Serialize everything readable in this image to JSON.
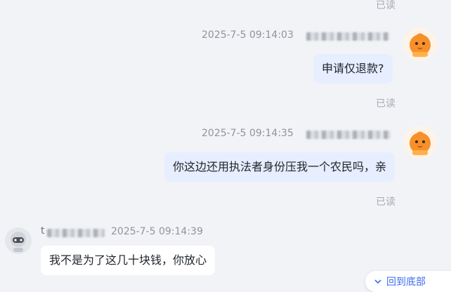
{
  "messages": [
    {
      "direction": "out",
      "status": "已读"
    },
    {
      "direction": "out",
      "timestamp": "2025-7-5 09:14:03",
      "text": "申请仅退款?",
      "status": "已读"
    },
    {
      "direction": "out",
      "timestamp": "2025-7-5 09:14:35",
      "text": "你这边还用执法者身份压我一个农民吗，亲",
      "status": "已读"
    },
    {
      "direction": "in",
      "sender_initial": "t",
      "timestamp": "2025-7-5 09:14:39",
      "text": "我不是为了这几十块钱，你放心"
    }
  ],
  "back_to_bottom": {
    "label": "回到底部",
    "icon": "chevron-down-icon"
  },
  "colors": {
    "outgoing_bubble": "#e6eeff",
    "incoming_bubble": "#ffffff",
    "read_status": "#a6aab3",
    "link": "#3c6df0",
    "avatar_accent": "#f7902a"
  }
}
